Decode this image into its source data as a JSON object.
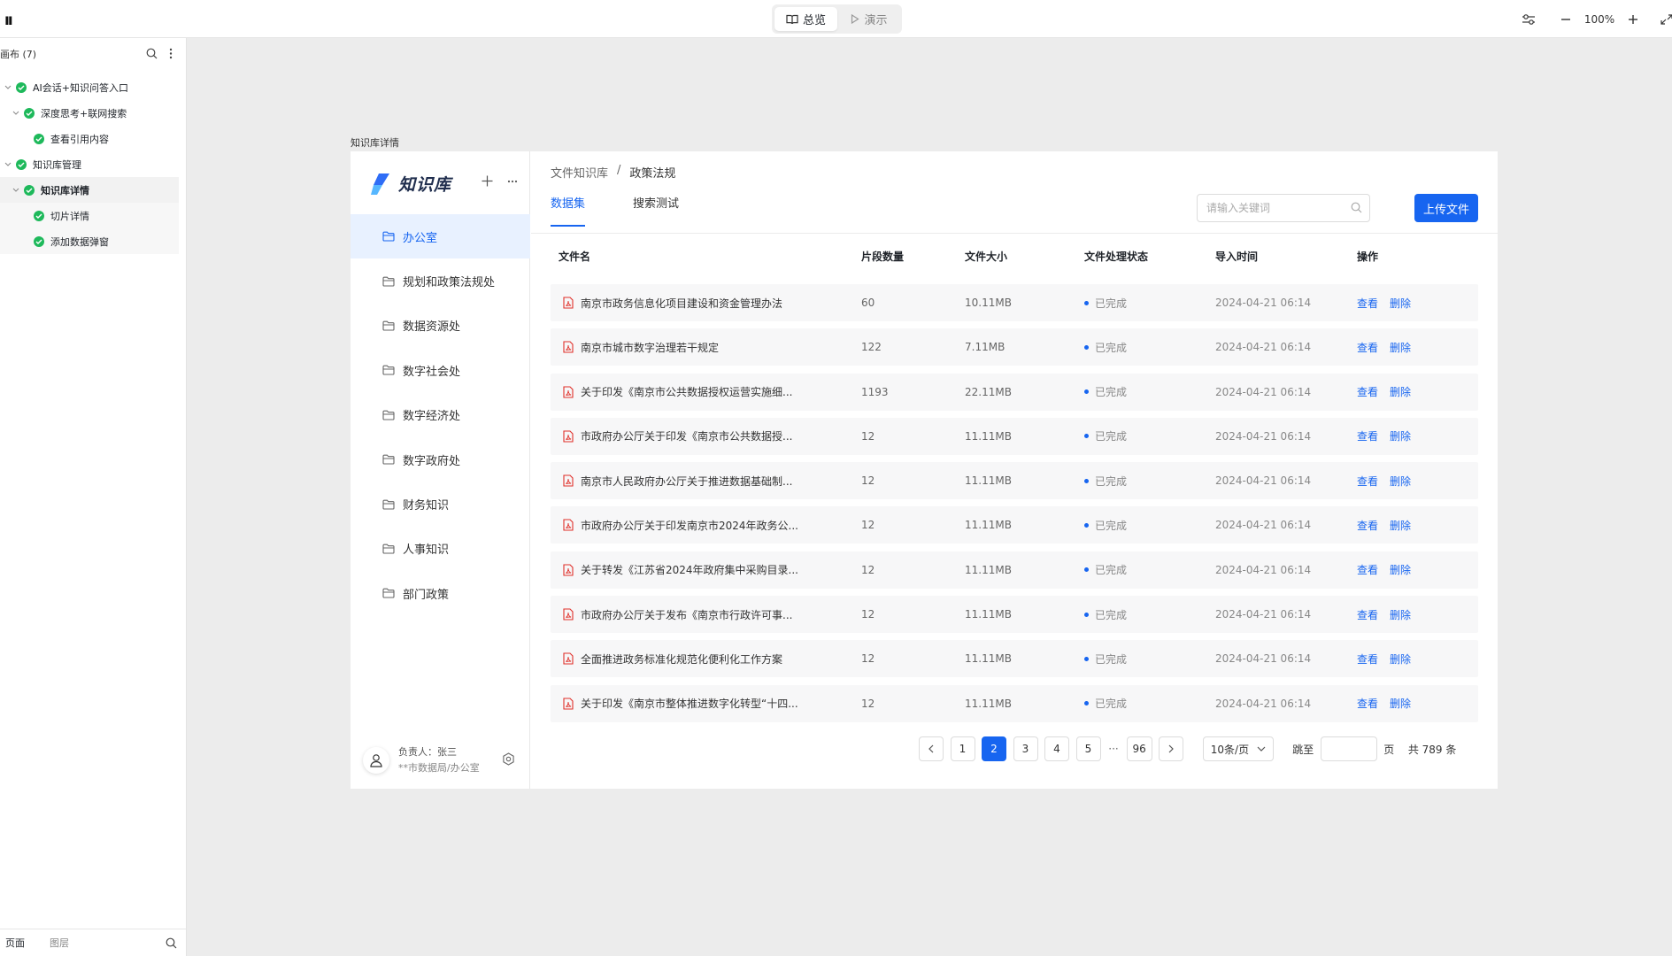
{
  "topbar": {
    "logo": "ıı",
    "mode_overview": "总览",
    "mode_present": "演示",
    "zoom": "100%"
  },
  "layers_panel": {
    "title": "画布 (7)",
    "items": [
      {
        "label": "AI会话+知识问答入口",
        "level": 0
      },
      {
        "label": "深度思考+联网搜索",
        "level": 1
      },
      {
        "label": "查看引用内容",
        "level": 2
      },
      {
        "label": "知识库管理",
        "level": 0
      },
      {
        "label": "知识库详情",
        "level": 1
      },
      {
        "label": "切片详情",
        "level": 2
      },
      {
        "label": "添加数据弹窗",
        "level": 2
      }
    ],
    "footer_tabs": [
      "页面",
      "图层"
    ]
  },
  "frame": {
    "label": "知识库详情"
  },
  "kb_sidebar": {
    "brand": "知识库",
    "nav": [
      "办公室",
      "规划和政策法规处",
      "数据资源处",
      "数字社会处",
      "数字经济处",
      "数字政府处",
      "财务知识",
      "人事知识",
      "部门政策"
    ],
    "active_index": 0,
    "owner_label": "负责人：张三",
    "owner_dept": "**市数据局/办公室"
  },
  "main": {
    "breadcrumb_root": "文件知识库",
    "breadcrumb_sep": "/",
    "breadcrumb_current": "政策法规",
    "tab_dataset": "数据集",
    "tab_search_test": "搜索测试",
    "search_placeholder": "请输入关键词",
    "upload_label": "上传文件"
  },
  "table": {
    "headers": {
      "name": "文件名",
      "count": "片段数量",
      "size": "文件大小",
      "status": "文件处理状态",
      "time": "导入时间",
      "ops": "操作"
    },
    "view_label": "查看",
    "delete_label": "删除",
    "rows": [
      {
        "name": "南京市政务信息化项目建设和资金管理办法",
        "count": "60",
        "size": "10.11MB",
        "status": "已完成",
        "time": "2024-04-21 06:14"
      },
      {
        "name": "南京市城市数字治理若干规定",
        "count": "122",
        "size": "7.11MB",
        "status": "已完成",
        "time": "2024-04-21 06:14"
      },
      {
        "name": "关于印发《南京市公共数据授权运营实施细...",
        "count": "1193",
        "size": "22.11MB",
        "status": "已完成",
        "time": "2024-04-21 06:14"
      },
      {
        "name": "市政府办公厅关于印发《南京市公共数据授...",
        "count": "12",
        "size": "11.11MB",
        "status": "已完成",
        "time": "2024-04-21 06:14"
      },
      {
        "name": "南京市人民政府办公厅关于推进数据基础制...",
        "count": "12",
        "size": "11.11MB",
        "status": "已完成",
        "time": "2024-04-21 06:14"
      },
      {
        "name": "市政府办公厅关于印发南京市2024年政务公...",
        "count": "12",
        "size": "11.11MB",
        "status": "已完成",
        "time": "2024-04-21 06:14"
      },
      {
        "name": "关于转发《江苏省2024年政府集中采购目录...",
        "count": "12",
        "size": "11.11MB",
        "status": "已完成",
        "time": "2024-04-21 06:14"
      },
      {
        "name": "市政府办公厅关于发布《南京市行政许可事...",
        "count": "12",
        "size": "11.11MB",
        "status": "已完成",
        "time": "2024-04-21 06:14"
      },
      {
        "name": "全面推进政务标准化规范化便利化工作方案",
        "count": "12",
        "size": "11.11MB",
        "status": "已完成",
        "time": "2024-04-21 06:14"
      },
      {
        "name": "关于印发《南京市整体推进数字化转型“十四...",
        "count": "12",
        "size": "11.11MB",
        "status": "已完成",
        "time": "2024-04-21 06:14"
      }
    ]
  },
  "pagination": {
    "pages": [
      "1",
      "2",
      "3",
      "4",
      "5"
    ],
    "active_page": "2",
    "ellipsis": "···",
    "last_page": "96",
    "page_size": "10条/页",
    "jump_label": "跳至",
    "page_unit": "页",
    "total": "共 789 条"
  },
  "colors": {
    "accent": "#1765f0",
    "success": "#1eb95b",
    "pdf": "#e0302a"
  }
}
